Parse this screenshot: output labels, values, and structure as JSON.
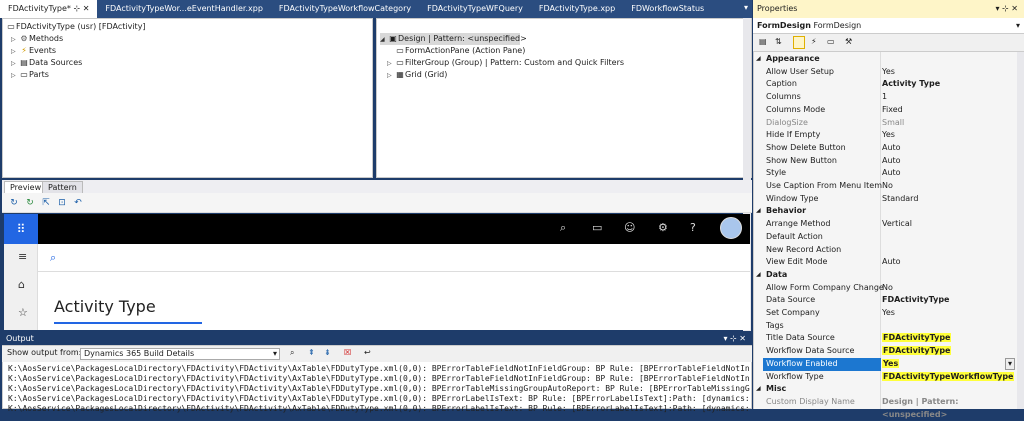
{
  "tabs": [
    {
      "label": "FDActivityType*",
      "pin": "⊹ ✕",
      "active": true
    },
    {
      "label": "FDActivityTypeWor...eEventHandler.xpp"
    },
    {
      "label": "FDActivityTypeWorkflowCategory"
    },
    {
      "label": "FDActivityTypeWFQuery"
    },
    {
      "label": "FDActivityType.xpp"
    },
    {
      "label": "FDWorkflowStatus"
    }
  ],
  "left_tree": {
    "root": "FDActivityType (usr) [FDActivity]",
    "items": [
      "Methods",
      "Events",
      "Data Sources",
      "Parts"
    ]
  },
  "right_tree": {
    "root": "Design | Pattern: <unspecified>",
    "items": [
      "FormActionPane (Action Pane)",
      "FilterGroup (Group) | Pattern: Custom and Quick Filters",
      "Grid (Grid)"
    ]
  },
  "preview": {
    "tabs": [
      "Preview",
      "Pattern"
    ],
    "page_title": "Activity Type"
  },
  "output": {
    "title": "Output",
    "show_from_label": "Show output from:",
    "source": "Dynamics 365 Build Details",
    "lines": [
      "K:\\AosService\\PackagesLocalDirectory\\FDActivity\\FDActivity\\AxTable\\FDDutyType.xml(0,0):  BPErrorTableFieldNotInFieldGroup: BP Rule: [BPErrorTableFieldNotIn",
      "K:\\AosService\\PackagesLocalDirectory\\FDActivity\\FDActivity\\AxTable\\FDDutyType.xml(0,0):  BPErrorTableFieldNotInFieldGroup: BP Rule: [BPErrorTableFieldNotIn",
      "K:\\AosService\\PackagesLocalDirectory\\FDActivity\\FDActivity\\AxTable\\FDDutyType.xml(0,0):  BPErrorTableMissingGroupAutoReport: BP Rule: [BPErrorTableMissingG",
      "K:\\AosService\\PackagesLocalDirectory\\FDActivity\\FDActivity\\AxTable\\FDDutyType.xml(0,0):  BPErrorLabelIsText: BP Rule: [BPErrorLabelIsText]:Path: [dynamics:",
      "K:\\AosService\\PackagesLocalDirectory\\FDActivity\\FDActivity\\AxTable\\FDDutyType.xml(0,0):  BPErrorLabelIsText: BP Rule: [BPErrorLabelIsText]:Path: [dynamics:"
    ]
  },
  "properties": {
    "title": "Properties",
    "title_icons": "▾ ⊹ ✕",
    "subject_bold": "FormDesign",
    "subject": "FormDesign",
    "rows": [
      {
        "type": "cat",
        "name": "Appearance"
      },
      {
        "name": "Allow User Setup",
        "value": "Yes"
      },
      {
        "name": "Caption",
        "value": "Activity Type",
        "bold": true
      },
      {
        "name": "Columns",
        "value": "1"
      },
      {
        "name": "Columns Mode",
        "value": "Fixed"
      },
      {
        "name": "DialogSize",
        "value": "Small",
        "muted": true
      },
      {
        "name": "Hide If Empty",
        "value": "Yes"
      },
      {
        "name": "Show Delete Button",
        "value": "Auto"
      },
      {
        "name": "Show New Button",
        "value": "Auto"
      },
      {
        "name": "Style",
        "value": "Auto"
      },
      {
        "name": "Use Caption From Menu Item",
        "value": "No"
      },
      {
        "name": "Window Type",
        "value": "Standard"
      },
      {
        "type": "cat",
        "name": "Behavior"
      },
      {
        "name": "Arrange Method",
        "value": "Vertical"
      },
      {
        "name": "Default Action",
        "value": ""
      },
      {
        "name": "New Record Action",
        "value": ""
      },
      {
        "name": "View Edit Mode",
        "value": "Auto"
      },
      {
        "type": "cat",
        "name": "Data"
      },
      {
        "name": "Allow Form Company Change",
        "value": "No"
      },
      {
        "name": "Data Source",
        "value": "FDActivityType",
        "bold": true
      },
      {
        "name": "Set Company",
        "value": "Yes"
      },
      {
        "name": "Tags",
        "value": ""
      },
      {
        "name": "Title Data Source",
        "value": "FDActivityType",
        "bold": true,
        "highlight": true
      },
      {
        "name": "Workflow Data Source",
        "value": "FDActivityType",
        "bold": true,
        "highlight": true
      },
      {
        "name": "Workflow Enabled",
        "value": "Yes",
        "bold": true,
        "highlight": true,
        "selected": true
      },
      {
        "name": "Workflow Type",
        "value": "FDActivityTypeWorkflowType",
        "bold": true,
        "highlight": true
      },
      {
        "type": "cat",
        "name": "Misc"
      },
      {
        "name": "Custom Display Name",
        "value": "Design | Pattern: <unspecified>",
        "bold": true,
        "muted": true
      }
    ]
  }
}
